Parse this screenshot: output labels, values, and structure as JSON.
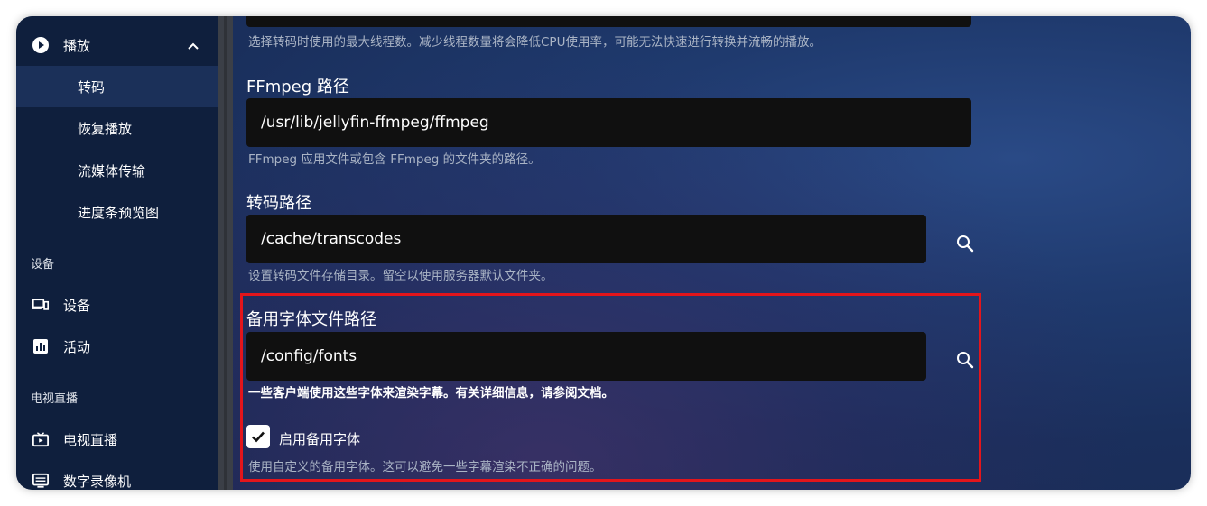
{
  "sidebar": {
    "playback": {
      "label": "播放"
    },
    "sub_items": [
      {
        "label": "转码",
        "active": true
      },
      {
        "label": "恢复播放",
        "active": false
      },
      {
        "label": "流媒体传输",
        "active": false
      },
      {
        "label": "进度条预览图",
        "active": false
      }
    ],
    "devices_section": "设备",
    "devices_items": [
      {
        "label": "设备",
        "icon": "devices-icon"
      },
      {
        "label": "活动",
        "icon": "activity-icon"
      }
    ],
    "livetv_section": "电视直播",
    "livetv_items": [
      {
        "label": "电视直播",
        "icon": "live-tv-icon"
      },
      {
        "label": "数字录像机",
        "icon": "dvr-icon"
      }
    ]
  },
  "main": {
    "threads_help": "选择转码时使用的最大线程数。减少线程数量将会降低CPU使用率，可能无法快速进行转换并流畅的播放。",
    "ffmpeg": {
      "label": "FFmpeg 路径",
      "value": "/usr/lib/jellyfin-ffmpeg/ffmpeg",
      "help": "FFmpeg 应用文件或包含 FFmpeg 的文件夹的路径。"
    },
    "transcode_path": {
      "label": "转码路径",
      "value": "/cache/transcodes",
      "help": "设置转码文件存储目录。留空以使用服务器默认文件夹。"
    },
    "fallback_font": {
      "label": "备用字体文件路径",
      "value": "/config/fonts",
      "help": "一些客户端使用这些字体来渲染字幕。有关详细信息，请参阅文档。"
    },
    "enable_fallback": {
      "label": "启用备用字体",
      "checked": true,
      "help": "使用自定义的备用字体。这可以避免一些字幕渲染不正确的问题。"
    }
  },
  "colors": {
    "highlight": "#e3151b",
    "sidebar_bg": "#0f1f3d",
    "input_bg": "#101010"
  }
}
